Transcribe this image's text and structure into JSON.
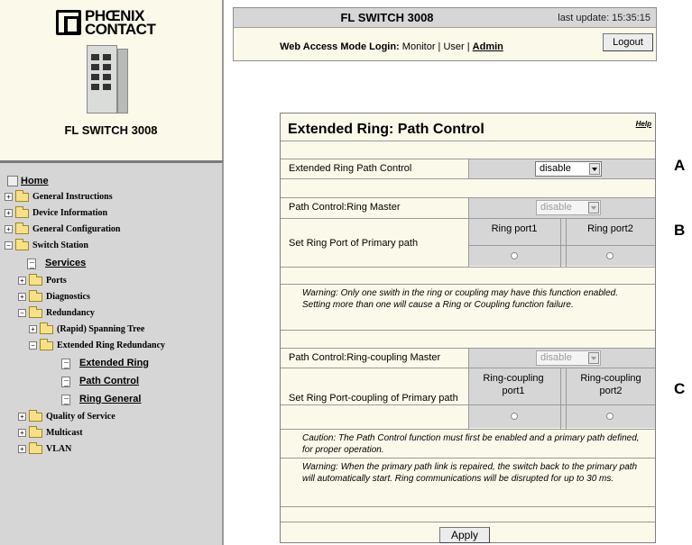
{
  "device": {
    "logo_line1": "PHŒNIX",
    "logo_line2": "CONTACT",
    "name": "FL SWITCH 3008"
  },
  "nav": {
    "home": "Home",
    "items": [
      {
        "label": "General Instructions"
      },
      {
        "label": "Device Information"
      },
      {
        "label": "General Configuration"
      },
      {
        "label": "Switch Station"
      },
      {
        "label": "Services"
      },
      {
        "label": "Ports"
      },
      {
        "label": "Diagnostics"
      },
      {
        "label": "Redundancy"
      },
      {
        "label": "(Rapid) Spanning Tree"
      },
      {
        "label": "Extended Ring Redundancy"
      },
      {
        "label": "Extended Ring"
      },
      {
        "label": "Path Control"
      },
      {
        "label": "Ring General"
      },
      {
        "label": "Quality of Service"
      },
      {
        "label": "Multicast"
      },
      {
        "label": "VLAN"
      }
    ]
  },
  "header": {
    "title": "FL SWITCH 3008",
    "last_update": "last update: 15:35:15",
    "login_prefix": "Web Access Mode Login:",
    "login_modes": "Monitor | User |",
    "login_admin": "Admin",
    "logout_label": "Logout"
  },
  "panel": {
    "title": "Extended Ring: Path Control",
    "help": "Help",
    "ring_path_control_label": "Extended Ring Path Control",
    "ring_path_control_value": "disable",
    "ring_master_label": "Path Control:Ring Master",
    "ring_master_value": "disable",
    "primary_path_label": "Set Ring Port of Primary path",
    "ring_port1": "Ring port1",
    "ring_port2": "Ring port2",
    "warning1": "Warning: Only one swith in the ring or coupling may have this function enabled. Setting more than one will cause a Ring or Coupling function failure.",
    "coupling_master_label": "Path Control:Ring-coupling Master",
    "coupling_master_value": "disable",
    "coupling_primary_label": "Set Ring Port-coupling of Primary path",
    "coupling_port1": "Ring-coupling port1",
    "coupling_port2": "Ring-coupling port2",
    "caution": "Caution: The Path Control function must first be enabled and a primary path defined, for proper operation.",
    "warning2": "Warning: When the primary path link is repaired, the switch back to the primary path will automatically start. Ring communications will be disrupted for up to 30 ms.",
    "apply_label": "Apply"
  },
  "markers": {
    "a": "A",
    "b": "B",
    "c": "C"
  }
}
